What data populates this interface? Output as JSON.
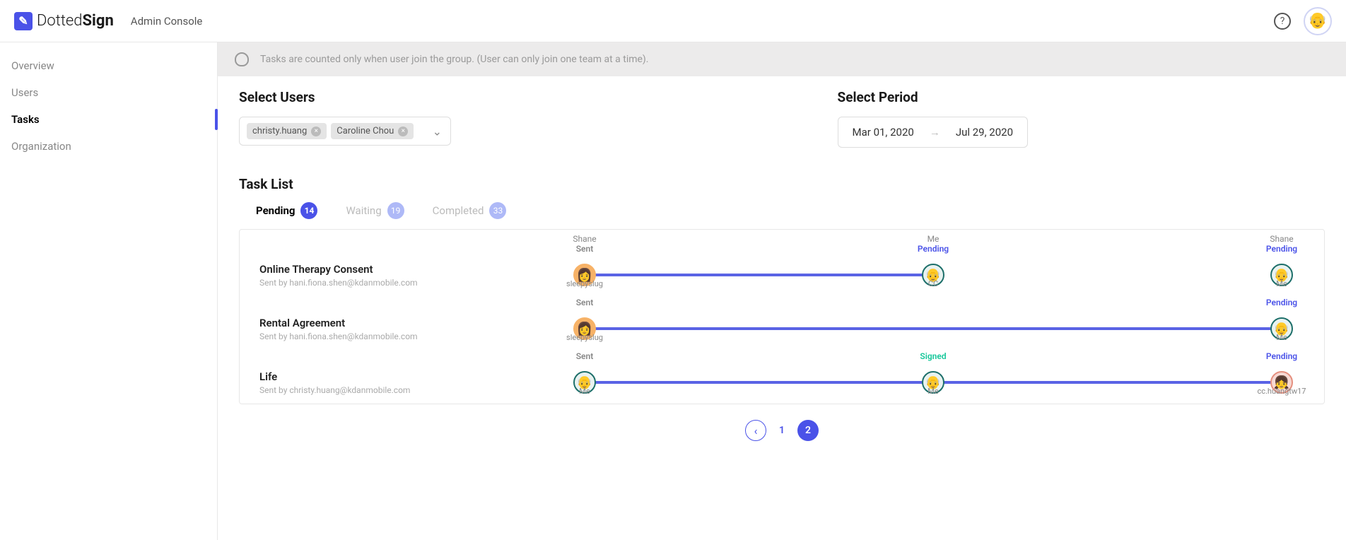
{
  "header": {
    "logo_thin": "Dotted",
    "logo_bold": "Sign",
    "admin_label": "Admin Console"
  },
  "sidebar": {
    "items": [
      {
        "label": "Overview",
        "active": false
      },
      {
        "label": "Users",
        "active": false
      },
      {
        "label": "Tasks",
        "active": true
      },
      {
        "label": "Organization",
        "active": false
      }
    ]
  },
  "info_bar": {
    "text": "Tasks are counted only when user join the group. (User can only join one team at a time)."
  },
  "filters": {
    "users_heading": "Select Users",
    "period_heading": "Select Period",
    "chips": [
      {
        "label": "christy.huang"
      },
      {
        "label": "Caroline Chou"
      }
    ],
    "period_start": "Mar 01, 2020",
    "period_end": "Jul 29, 2020"
  },
  "task_list_heading": "Task List",
  "tabs": [
    {
      "label": "Pending",
      "count": "14",
      "active": true
    },
    {
      "label": "Waiting",
      "count": "19",
      "active": false
    },
    {
      "label": "Completed",
      "count": "33",
      "active": false
    }
  ],
  "top_labels": [
    {
      "text": "Shane",
      "pos": 0
    },
    {
      "text": "Me",
      "pos": 50
    },
    {
      "text": "Shane",
      "pos": 100
    }
  ],
  "tasks": [
    {
      "title": "Online Therapy Consent",
      "subtitle": "Sent by hani.fiona.shen@kdanmobile.com",
      "nodes": [
        {
          "pos": 0,
          "status": "Sent",
          "status_class": "sent",
          "name": "sleepyslug",
          "avatar_class": "orange",
          "emoji": "👩"
        },
        {
          "pos": 50,
          "status": "Pending",
          "status_class": "pending",
          "name": "CC",
          "avatar_class": "teal",
          "emoji": "👴"
        },
        {
          "pos": 100,
          "status": "Pending",
          "status_class": "pending",
          "name": "Me",
          "avatar_class": "teal",
          "emoji": "👴"
        }
      ],
      "line_from": 0,
      "line_to": 50
    },
    {
      "title": "Rental Agreement",
      "subtitle": "Sent by hani.fiona.shen@kdanmobile.com",
      "nodes": [
        {
          "pos": 0,
          "status": "Sent",
          "status_class": "sent",
          "name": "sleepyslug",
          "avatar_class": "orange",
          "emoji": "👩"
        },
        {
          "pos": 100,
          "status": "Pending",
          "status_class": "pending",
          "name": "Me",
          "avatar_class": "teal",
          "emoji": "👴"
        }
      ],
      "line_from": 0,
      "line_to": 100
    },
    {
      "title": "Life",
      "subtitle": "Sent by christy.huang@kdanmobile.com",
      "nodes": [
        {
          "pos": 0,
          "status": "Sent",
          "status_class": "sent",
          "name": "Me",
          "avatar_class": "teal",
          "emoji": "👴"
        },
        {
          "pos": 50,
          "status": "Signed",
          "status_class": "signed",
          "name": "Me",
          "avatar_class": "teal",
          "emoji": "👴"
        },
        {
          "pos": 100,
          "status": "Pending",
          "status_class": "pending",
          "name": "cc.huangtw17",
          "avatar_class": "pink",
          "emoji": "👧"
        }
      ],
      "line_from": 0,
      "line_to": 100
    }
  ],
  "pagination": {
    "pages": [
      "1",
      "2"
    ],
    "active": "2"
  }
}
